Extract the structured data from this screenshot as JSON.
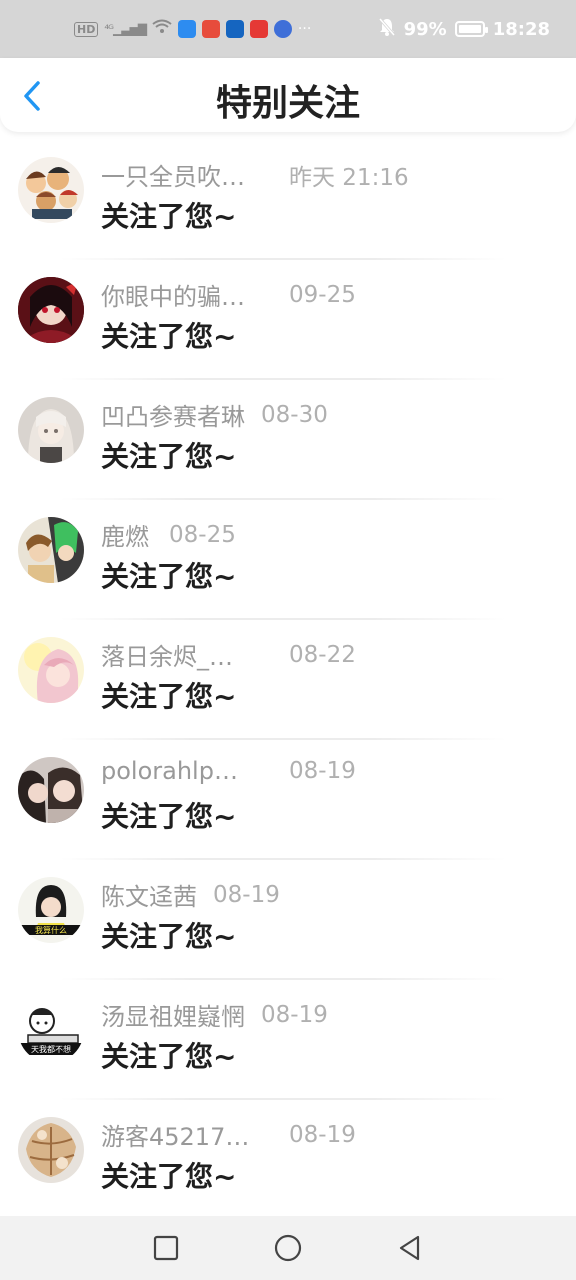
{
  "status_bar": {
    "left_icons": [
      "hd-icon",
      "4g-signal-icon",
      "wifi-icon",
      "app-notification-icon"
    ],
    "more": "···",
    "battery": "99%",
    "battery_level": 0.99,
    "time": "18:28"
  },
  "header": {
    "title": "特别关注",
    "back_icon": "chevron-left-icon",
    "accent_color": "#2196f3"
  },
  "items": [
    {
      "name": "一只全员吹…",
      "time": "昨天 21:16",
      "message": "关注了您~"
    },
    {
      "name": "你眼中的骗…",
      "time": "09-25",
      "message": "关注了您~"
    },
    {
      "name": "凹凸参赛者琳",
      "time": "08-30",
      "message": "关注了您~"
    },
    {
      "name": "鹿燃",
      "time": "08-25",
      "message": "关注了您~"
    },
    {
      "name": "落日余烬_…",
      "time": "08-22",
      "message": "关注了您~"
    },
    {
      "name": "polorahlp…",
      "time": "08-19",
      "message": "关注了您~"
    },
    {
      "name": "陈文迳茜",
      "time": "08-19",
      "message": "关注了您~"
    },
    {
      "name": "汤显祖娌嶷惘",
      "time": "08-19",
      "message": "关注了您~"
    },
    {
      "name": "游客45217…",
      "time": "08-19",
      "message": "关注了您~"
    }
  ],
  "avatar_texts": {
    "avatar_7": "我算什么",
    "avatar_8": "天我都不想"
  },
  "navbar": {
    "icons": [
      "square-recent-icon",
      "circle-home-icon",
      "triangle-back-icon"
    ]
  }
}
